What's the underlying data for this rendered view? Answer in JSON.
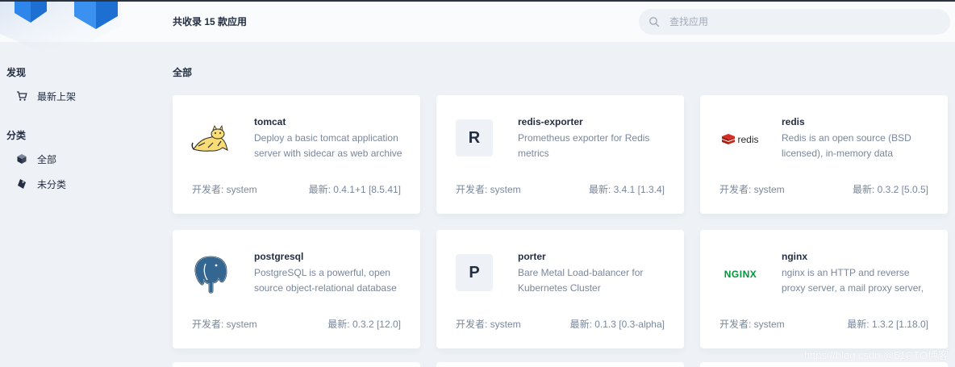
{
  "header": {
    "count_text": "共收录 15 款应用",
    "search_placeholder": "查找应用"
  },
  "sidebar": {
    "discover_title": "发现",
    "discover_items": [
      {
        "label": "最新上架",
        "icon": "cart-icon"
      }
    ],
    "category_title": "分类",
    "category_items": [
      {
        "label": "全部",
        "icon": "cube-icon"
      },
      {
        "label": "未分类",
        "icon": "tag-icon"
      }
    ]
  },
  "main": {
    "title": "全部",
    "apps": [
      {
        "name": "tomcat",
        "desc": "Deploy a basic tomcat application server with sidecar as web archive",
        "developer": "开发者: system",
        "latest": "最新: 0.4.1+1 [8.5.41]",
        "icon": "tomcat-logo-icon"
      },
      {
        "name": "redis-exporter",
        "desc": "Prometheus exporter for Redis metrics",
        "developer": "开发者: system",
        "latest": "最新: 3.4.1 [1.3.4]",
        "icon_letter": "R"
      },
      {
        "name": "redis",
        "desc": "Redis is an open source (BSD licensed), in-memory data",
        "developer": "开发者: system",
        "latest": "最新: 0.3.2 [5.0.5]",
        "icon": "redis-logo-icon",
        "icon_text": "redis"
      },
      {
        "name": "postgresql",
        "desc": "PostgreSQL is a powerful, open source object-relational database",
        "developer": "开发者: system",
        "latest": "最新: 0.3.2 [12.0]",
        "icon": "postgresql-logo-icon"
      },
      {
        "name": "porter",
        "desc": "Bare Metal Load-balancer for Kubernetes Cluster",
        "developer": "开发者: system",
        "latest": "最新: 0.1.3 [0.3-alpha]",
        "icon_letter": "P"
      },
      {
        "name": "nginx",
        "desc": "nginx is an HTTP and reverse proxy server, a mail proxy server,",
        "developer": "开发者: system",
        "latest": "最新: 1.3.2 [1.18.0]",
        "icon": "nginx-logo-icon",
        "icon_text": "NGINX"
      }
    ]
  },
  "watermark": "https://blog.csdn.@51CTO博客",
  "colors": {
    "background": "#eef2f6",
    "card": "#ffffff",
    "text": "#242e42",
    "muted": "#79879c",
    "nginx": "#009639",
    "redis": "#d82c20"
  }
}
